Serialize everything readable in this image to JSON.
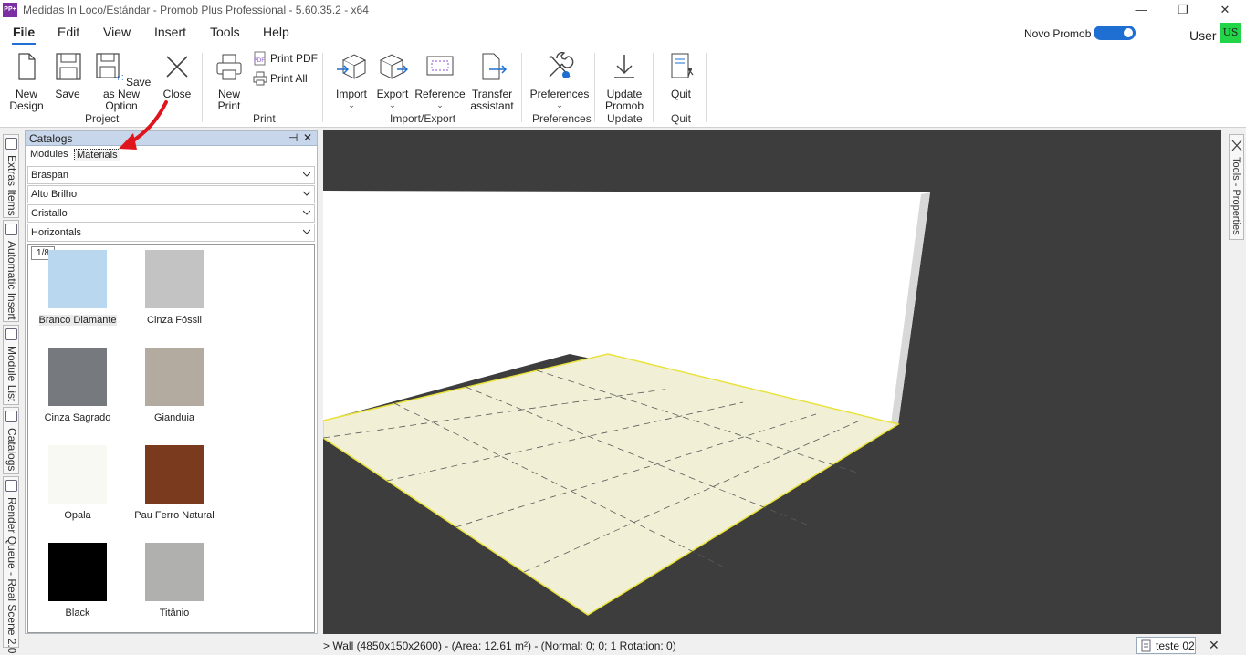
{
  "window": {
    "title": "Medidas In Loco/Estándar - Promob Plus Professional - 5.60.35.2 - x64",
    "app_icon_text": "PP+",
    "minimize": "—",
    "maximize": "❐",
    "close": "✕"
  },
  "menu": {
    "items": [
      "File",
      "Edit",
      "View",
      "Insert",
      "Tools",
      "Help"
    ],
    "novo_promob_label": "Novo Promob",
    "novo_promob_enabled": true,
    "user_label": "User",
    "user_initials": "US"
  },
  "ribbon": {
    "project": {
      "group_label": "Project",
      "new_design": [
        "New",
        "Design"
      ],
      "save": "Save",
      "save_as_new_option": [
        "Save as New",
        "Option"
      ],
      "close": "Close"
    },
    "print": {
      "group_label": "Print",
      "new_print": [
        "New",
        "Print"
      ],
      "print_pdf": "Print PDF",
      "print_all": "Print All"
    },
    "import_export": {
      "group_label": "Import/Export",
      "import": "Import",
      "export": "Export",
      "reference": "Reference",
      "transfer_assistant": [
        "Transfer",
        "assistant"
      ]
    },
    "preferences": {
      "group_label": "Preferences",
      "preferences": "Preferences"
    },
    "update": {
      "group_label": "Update",
      "update_promob": [
        "Update",
        "Promob"
      ]
    },
    "quit": {
      "group_label": "Quit",
      "quit": "Quit"
    }
  },
  "left_tabs": [
    "Extras Items",
    "Automatic Insert",
    "Module List",
    "Catalogs",
    "Render Queue - Real Scene 2.0"
  ],
  "catalogs": {
    "title": "Catalogs",
    "pin": "⊣",
    "close": "✕",
    "tabs": [
      "Modules",
      "Materials"
    ],
    "active_tab": "Materials",
    "dropdowns": [
      "Braspan",
      "Alto Brilho",
      "Cristallo",
      "Horizontals"
    ],
    "page": "1/8",
    "materials": [
      {
        "name": "Branco Diamante",
        "color": "#b9d7ef",
        "selected": true
      },
      {
        "name": "Cinza Fóssil",
        "color": "#c3c3c3",
        "selected": false
      },
      {
        "name": "Cinza Sagrado",
        "color": "#767a7f",
        "selected": false
      },
      {
        "name": "Gianduia",
        "color": "#b3aaa0",
        "selected": false
      },
      {
        "name": "Opala",
        "color": "#f8f9f3",
        "selected": false
      },
      {
        "name": "Pau Ferro Natural",
        "color": "#7a3a1e",
        "selected": false
      },
      {
        "name": "Black",
        "color": "#000000",
        "selected": false
      },
      {
        "name": "Titânio",
        "color": "#b0b0ae",
        "selected": false
      }
    ]
  },
  "right_tab": "Tools - Properties",
  "status": {
    "text": "> Wall (4850x150x2600) - (Area: 12.61 m²) - (Normal: 0; 0; 1 Rotation: 0)",
    "document_tab": "teste 02",
    "document_close": "✕"
  },
  "colors": {
    "accent": "#1e6fd1",
    "panel_header": "#c7d6ea",
    "viewport_bg": "#3d3d3d",
    "floor": "#f1f0d6",
    "annotation_arrow": "#e0141c"
  }
}
